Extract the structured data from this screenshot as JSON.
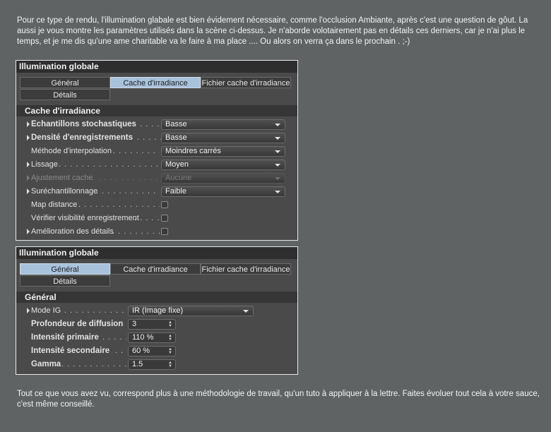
{
  "intro_text": "Pour ce type de rendu, l'illumination glabale est bien évidement nécessaire, comme l'occlusion Ambiante, après c'est une question de gôut. La aussi je vous montre les paramètres utilisés dans la scène ci-dessus. Je n'aborde volotairement pas en détails ces derniers, car je n'ai plus le temps, et je me dis qu'une ame charitable va le faire à ma place .... Ou alors on verra ça dans le prochain . ;-)",
  "panel1": {
    "title": "Illumination globale",
    "tabs": [
      "Général",
      "Cache d'irradiance",
      "Fichier cache d'irradiance",
      "Détails"
    ],
    "active_tab": "Cache d'irradiance",
    "section": "Cache d'irradiance",
    "rows": [
      {
        "label": "Echantillons stochastiques",
        "dots": ". . . .",
        "value": "Basse"
      },
      {
        "label": "Densité d'enregistrements",
        "dots": ". . . . .",
        "value": "Basse"
      },
      {
        "label": "Méthode d'interpolation",
        "dots": ". . . . . . . . . . .",
        "value": "Moindres carrés"
      },
      {
        "label": "Lissage",
        "dots": ". . . . . . . . . . . . . . . . . . . . .",
        "value": "Moyen"
      },
      {
        "label": "Ajustement cache",
        "dots": ". . . . . . . . . . . . . . .",
        "value": "Aucune"
      },
      {
        "label": "Suréchantillonnage",
        "dots": ". . . . . . . . . . . . . .",
        "value": "Faible"
      },
      {
        "label": "Map distance",
        "dots": ". . . . . . . . . . . . . . . . . ."
      },
      {
        "label": "Vérifier visibilité enregistrement",
        "dots": ". . . . . ."
      },
      {
        "label": "Amélioration des détails",
        "dots": ". . . . . . . . . . ."
      }
    ]
  },
  "panel2": {
    "title": "Illumination globale",
    "tabs": [
      "Général",
      "Cache d'irradiance",
      "Fichier cache d'irradiance",
      "Détails"
    ],
    "active_tab": "Général",
    "section": "Général",
    "rows": [
      {
        "label": "Mode IG",
        "dots": ". . . . . . . . . . . . . . . .",
        "value": "IR (Image fixe)"
      },
      {
        "label": "Profondeur de diffusion",
        "dots": "",
        "value": "3"
      },
      {
        "label": "Intensité primaire",
        "dots": ". . . . .",
        "value": "110 %"
      },
      {
        "label": "Intensité secondaire",
        "dots": ". .",
        "value": "60 %"
      },
      {
        "label": "Gamma",
        "dots": ". . . . . . . . . . . . . . .",
        "value": "1.5"
      }
    ]
  },
  "outro_text": "Tout ce que vous avez vu, correspond plus à une méthodologie de travail, qu'un tuto à appliquer à la lettre. Faites évoluer tout cela à votre sauce, c'est même conseillé."
}
